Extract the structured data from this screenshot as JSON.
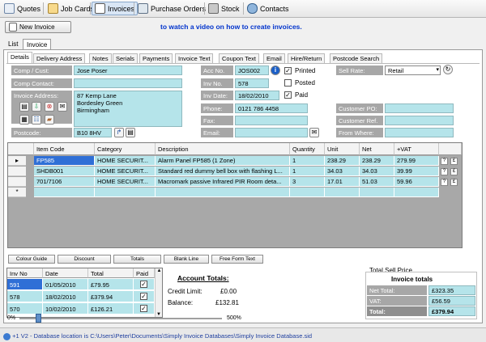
{
  "toolbar": {
    "items": [
      {
        "label": "Quotes",
        "icon": "quotes-icon"
      },
      {
        "label": "Job Cards",
        "icon": "job-cards-icon"
      },
      {
        "label": "Invoices",
        "icon": "invoices-icon"
      },
      {
        "label": "Purchase Orders",
        "icon": "purchase-orders-icon"
      },
      {
        "label": "Stock",
        "icon": "stock-icon"
      },
      {
        "label": "Contacts",
        "icon": "contacts-icon"
      }
    ]
  },
  "new_invoice_label": "New Invoice",
  "video_link": "to watch a video on how to create invoices.",
  "outer_tabs": [
    "List",
    "Invoice"
  ],
  "inner_tabs": [
    "Details",
    "Delivery Address",
    "Notes",
    "Serials",
    "Payments",
    "Invoice Text",
    "Coupon Text",
    "Email",
    "Hire/Return",
    "Postcode Search"
  ],
  "form": {
    "comp_cust_label": "Comp / Cust:",
    "comp_cust_value": "Jose Poser",
    "comp_contact_label": "Comp Contact:",
    "comp_contact_value": "",
    "invoice_address_label": "Invoice Address:",
    "address_lines": [
      "87 Kemp Lane",
      "Bordesley Green",
      "Birmingham"
    ],
    "postcode_label": "Postcode:",
    "postcode_value": "B10 8HV",
    "acc_no_label": "Acc No.",
    "acc_no_value": "JOS002",
    "inv_no_label": "Inv No.",
    "inv_no_value": "578",
    "inv_date_label": "Inv Date:",
    "inv_date_value": "18/02/2010",
    "phone_label": "Phone:",
    "phone_value": "0121 786 4458",
    "fax_label": "Fax:",
    "fax_value": "",
    "email_label": "Email:",
    "email_value": "",
    "printed_label": "Printed",
    "posted_label": "Posted",
    "paid_label": "Paid",
    "printed": true,
    "posted": false,
    "paid": true,
    "sell_rate_label": "Sell Rate:",
    "sell_rate_value": "Retail",
    "customer_po_label": "Customer PO:",
    "customer_ref_label": "Customer Ref.",
    "from_where_label": "From Where:"
  },
  "grid": {
    "headers": [
      "Item Code",
      "Category",
      "Description",
      "Quantity",
      "Unit",
      "Net",
      "+VAT"
    ],
    "rows": [
      {
        "code": "FP585",
        "category": "HOME SECURIT...",
        "description": "Alarm Panel FP585 (1 Zone)",
        "qty": "1",
        "unit": "238.29",
        "net": "238.29",
        "vat": "279.99"
      },
      {
        "code": "SHDB001",
        "category": "HOME SECURIT...",
        "description": "Standard red dummy bell box with flashing L...",
        "qty": "1",
        "unit": "34.03",
        "net": "34.03",
        "vat": "39.99"
      },
      {
        "code": "701/7106",
        "category": "HOME SECURIT...",
        "description": "Macromark passive Infrared PIR Room deta...",
        "qty": "3",
        "unit": "17.01",
        "net": "51.03",
        "vat": "59.96"
      }
    ]
  },
  "bottom_buttons": [
    "Colour Guide",
    "Discount",
    "Totals",
    "Blank Line",
    "Free Form Text"
  ],
  "invoice_list": {
    "headers": [
      "Inv No",
      "Date",
      "Total",
      "Paid"
    ],
    "rows": [
      {
        "no": "591",
        "date": "01/05/2010",
        "total": "£79.95",
        "paid": true
      },
      {
        "no": "578",
        "date": "18/02/2010",
        "total": "£379.94",
        "paid": true
      },
      {
        "no": "570",
        "date": "10/02/2010",
        "total": "£126.21",
        "paid": true
      }
    ]
  },
  "zoom": {
    "min": "0%",
    "max": "500%"
  },
  "account_totals": {
    "title": "Account Totals:",
    "credit_limit_label": "Credit Limit:",
    "credit_limit_value": "£0.00",
    "balance_label": "Balance:",
    "balance_value": "£132.81"
  },
  "totals": {
    "group_label": "Total Sell Price",
    "title": "Invoice totals",
    "net_label": "Net Total:",
    "net_value": "£323.35",
    "vat_label": "VAT:",
    "vat_value": "£56.59",
    "total_label": "Total:",
    "total_value": "£379.94"
  },
  "status_bar": "+1 V2  - Database location is C:\\Users\\Peter\\Documents\\Simply Invoice Databases\\Simply Invoice Database.sid"
}
